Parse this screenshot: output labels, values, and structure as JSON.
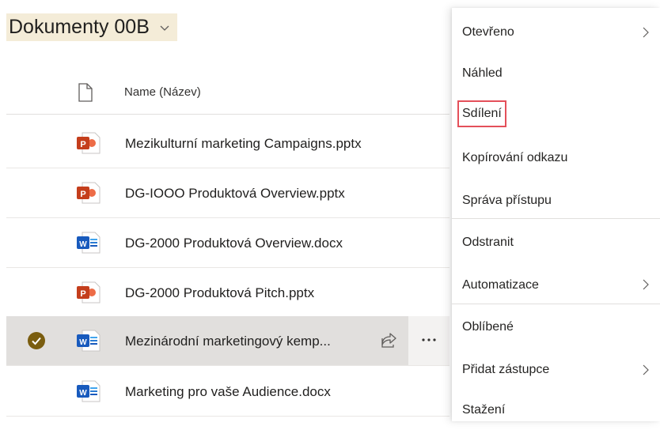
{
  "library": {
    "title": "Dokumenty 00B"
  },
  "list": {
    "column_name": "Name (Název)",
    "files": [
      {
        "name": "Mezikulturní marketing Campaigns.pptx",
        "type": "pptx"
      },
      {
        "name": "DG-IOOO Produktová Overview.pptx",
        "type": "pptx"
      },
      {
        "name": "DG-2000 Produktová Overview.docx",
        "type": "docx"
      },
      {
        "name": "DG-2000 Produktová Pitch.pptx",
        "type": "pptx"
      },
      {
        "name": "Mezinárodní marketingový kemp...",
        "type": "docx",
        "selected": true
      },
      {
        "name": "Marketing pro vaše Audience.docx",
        "type": "docx"
      }
    ]
  },
  "context_menu": {
    "items": [
      {
        "label": "Otevřeno",
        "submenu": true
      },
      {
        "label": "Náhled"
      },
      {
        "label": "Sdílení",
        "highlighted": true
      },
      {
        "label": "Kopírování odkazu"
      },
      {
        "label": "Správa přístupu"
      },
      {
        "label": "Odstranit"
      },
      {
        "label": "Automatizace",
        "submenu": true
      },
      {
        "label": "Oblíbené"
      },
      {
        "label": "Přidat zástupce",
        "submenu": true
      },
      {
        "label": "Stažení"
      }
    ]
  },
  "colors": {
    "pptx": "#c43e1c",
    "docx": "#185abd",
    "check": "#7a5d0f",
    "highlight_box": "#e4505a"
  }
}
